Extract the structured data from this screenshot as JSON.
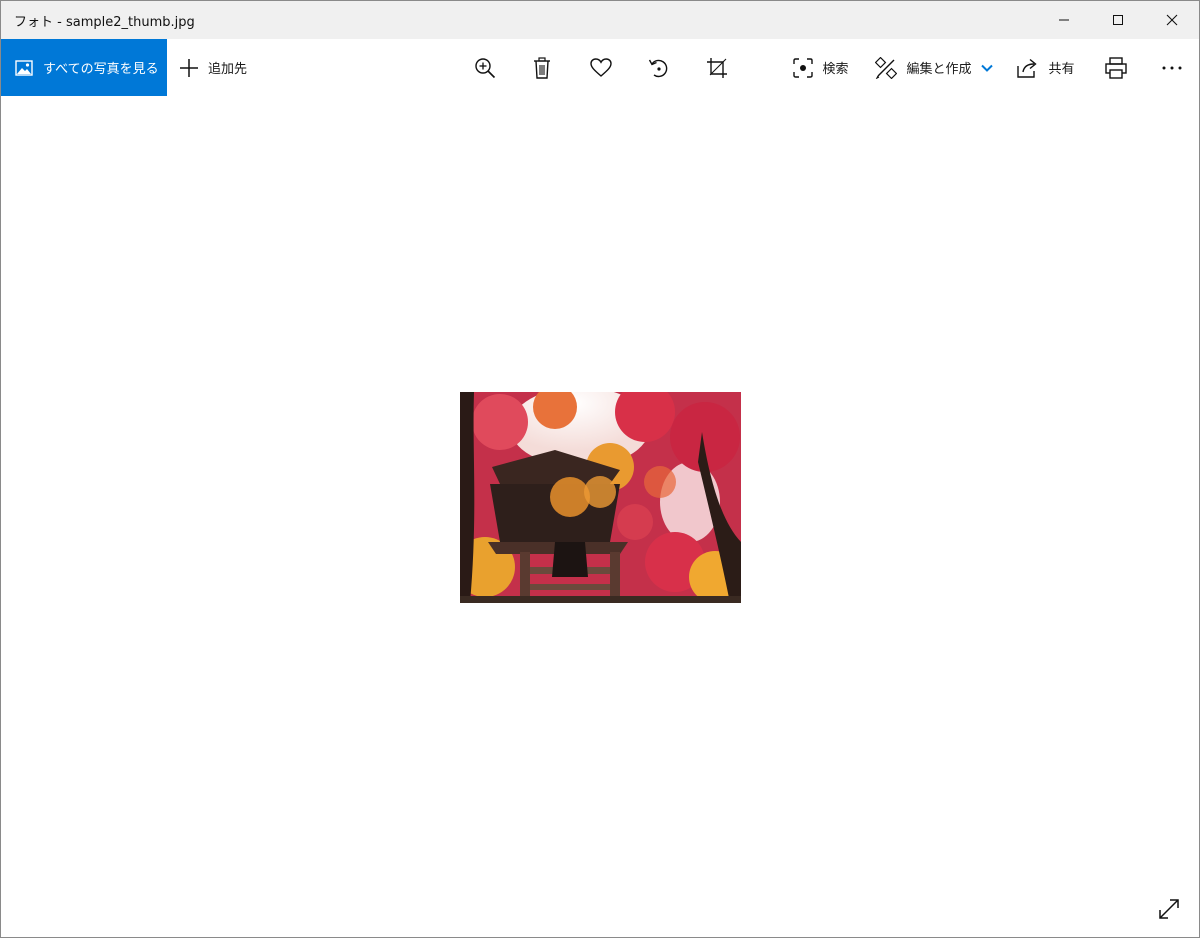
{
  "window": {
    "title": "フォト - sample2_thumb.jpg"
  },
  "title_controls": {
    "minimize_icon": "minimize-icon",
    "maximize_icon": "maximize-icon",
    "close_icon": "close-icon"
  },
  "toolbar": {
    "all_photos_label": "すべての写真を見る",
    "add_to_label": "追加先",
    "search_label": "検索",
    "edit_create_label": "編集と作成",
    "share_label": "共有",
    "icons": [
      "zoom-in-icon",
      "delete-icon",
      "favorite-icon",
      "rotate-icon",
      "crop-icon",
      "print-icon",
      "more-icon"
    ]
  },
  "colors": {
    "accent": "#0078d7",
    "titlebar": "#f0f0f0"
  },
  "viewer": {
    "image_icon": "photo-image",
    "fullscreen_icon": "fullscreen-icon"
  }
}
